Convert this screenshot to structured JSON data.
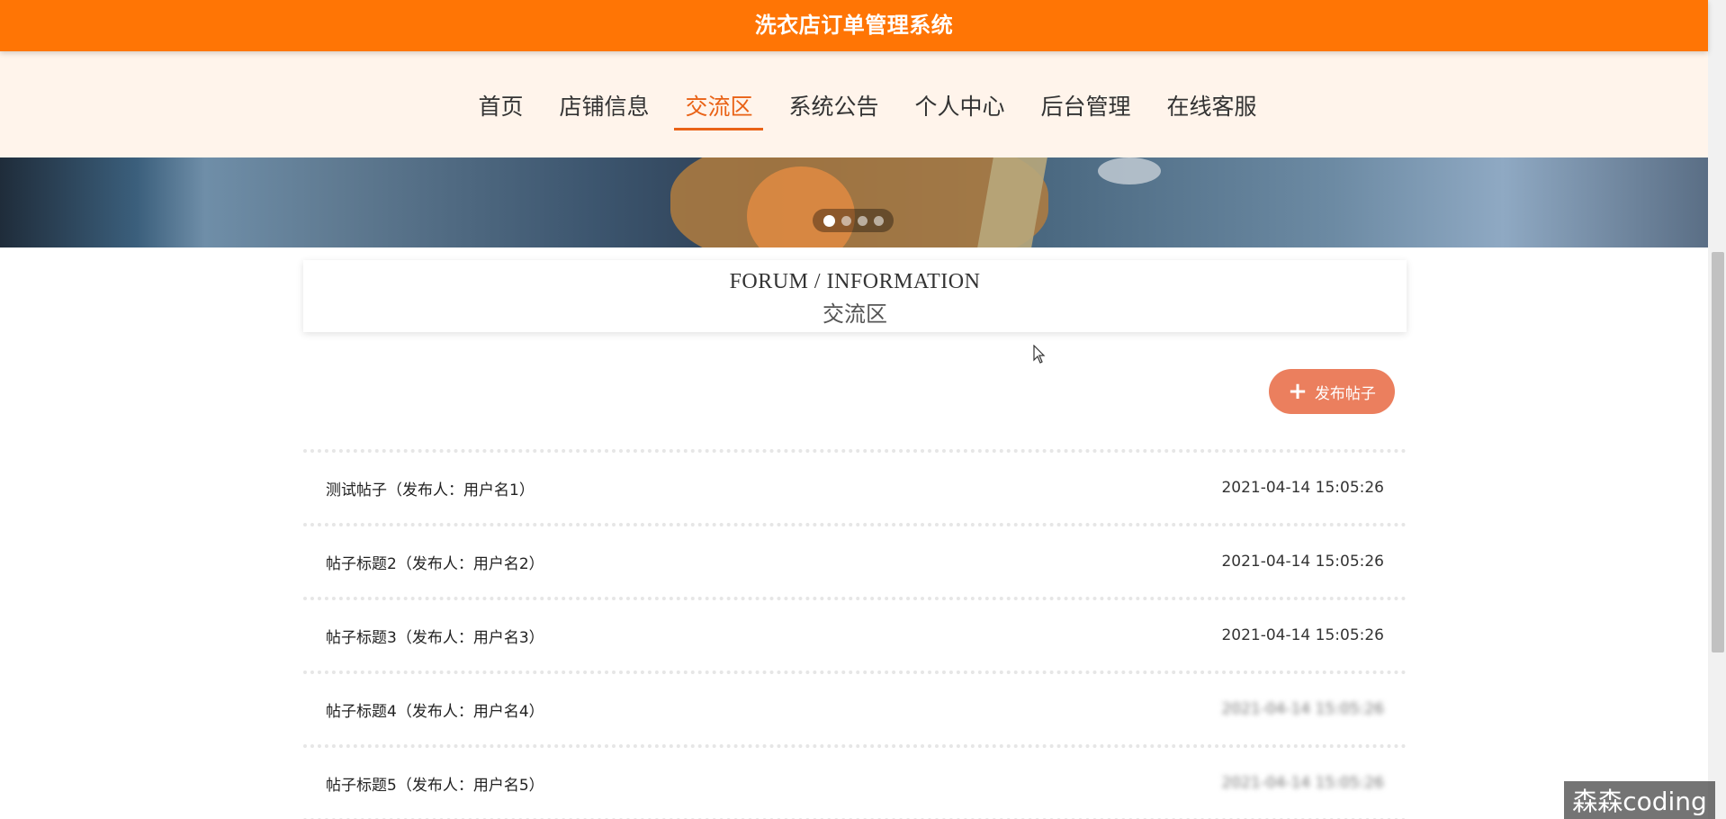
{
  "header": {
    "title": "洗衣店订单管理系统"
  },
  "nav": {
    "items": [
      {
        "label": "首页",
        "active": false
      },
      {
        "label": "店铺信息",
        "active": false
      },
      {
        "label": "交流区",
        "active": true
      },
      {
        "label": "系统公告",
        "active": false
      },
      {
        "label": "个人中心",
        "active": false
      },
      {
        "label": "后台管理",
        "active": false
      },
      {
        "label": "在线客服",
        "active": false
      }
    ]
  },
  "banner": {
    "slide_count": 4,
    "active_slide": 1
  },
  "section": {
    "title_en": "FORUM / INFORMATION",
    "title_zh": "交流区"
  },
  "actions": {
    "post_label": "发布帖子"
  },
  "posts": [
    {
      "title": "测试帖子（发布人：用户名1）",
      "time": "2021-04-14 15:05:26",
      "time_visible": true
    },
    {
      "title": "帖子标题2（发布人：用户名2）",
      "time": "2021-04-14 15:05:26",
      "time_visible": true
    },
    {
      "title": "帖子标题3（发布人：用户名3）",
      "time": "2021-04-14 15:05:26",
      "time_visible": true
    },
    {
      "title": "帖子标题4（发布人：用户名4）",
      "time": "2021-04-14 15:05:26",
      "time_visible": false
    },
    {
      "title": "帖子标题5（发布人：用户名5）",
      "time": "2021-04-14 15:05:26",
      "time_visible": false
    }
  ],
  "watermark": {
    "text": "森森coding"
  },
  "colors": {
    "header_bg": "#ff7505",
    "nav_bg": "#fff4eb",
    "accent": "#e96216",
    "button_bg": "#eb7f5e"
  }
}
